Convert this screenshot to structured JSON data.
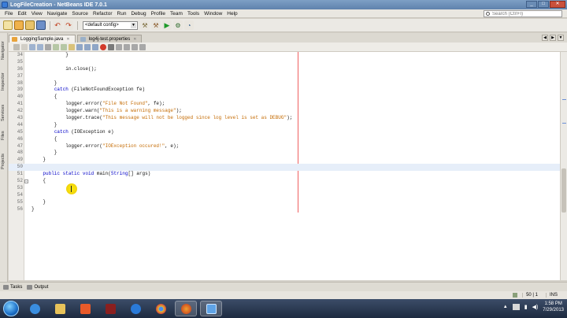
{
  "window": {
    "title": "LogFileCreation - NetBeans IDE 7.0.1"
  },
  "menu": [
    "File",
    "Edit",
    "View",
    "Navigate",
    "Source",
    "Refactor",
    "Run",
    "Debug",
    "Profile",
    "Team",
    "Tools",
    "Window",
    "Help"
  ],
  "search": {
    "placeholder": "Search (Ctrl+I)"
  },
  "toolbar": {
    "config_value": "<default config>"
  },
  "sidebar_tabs": [
    "Navigator",
    "Inspector",
    "Services",
    "Files",
    "Projects"
  ],
  "editor_tabs": [
    {
      "label": "LoggingSample.java",
      "active": true
    },
    {
      "label": "log4j-test.properties",
      "active": false
    }
  ],
  "code_lines": [
    {
      "num": "34",
      "code": "            }"
    },
    {
      "num": "35",
      "code": ""
    },
    {
      "num": "36",
      "code": "            in.close();"
    },
    {
      "num": "37",
      "code": ""
    },
    {
      "num": "38",
      "code": "        }"
    },
    {
      "num": "39",
      "code": "        catch (FileNotFoundException fe)"
    },
    {
      "num": "40",
      "code": "        {"
    },
    {
      "num": "41",
      "code": "            logger.error(\"File Not Found\", fe);"
    },
    {
      "num": "42",
      "code": "            logger.warn(\"This is a warning message\");"
    },
    {
      "num": "43",
      "code": "            logger.trace(\"This message will not be logged since log level is set as DEBUG\");"
    },
    {
      "num": "44",
      "code": "        }"
    },
    {
      "num": "45",
      "code": "        catch (IOException e)"
    },
    {
      "num": "46",
      "code": "        {"
    },
    {
      "num": "47",
      "code": "            logger.error(\"IOException occured!\", e);"
    },
    {
      "num": "48",
      "code": "        }"
    },
    {
      "num": "49",
      "code": "    }"
    },
    {
      "num": "50",
      "code": ""
    },
    {
      "num": "51",
      "code": "    public static void main(String[] args)"
    },
    {
      "num": "52",
      "code": "    {"
    },
    {
      "num": "53",
      "code": ""
    },
    {
      "num": "54",
      "code": ""
    },
    {
      "num": "55",
      "code": "    }"
    },
    {
      "num": "56",
      "code": "}"
    }
  ],
  "output": {
    "tab1": "Tasks",
    "tab2": "Output"
  },
  "status": {
    "insert_mode": "INS",
    "position": "50 | 1"
  },
  "clock": {
    "time": "1:58 PM",
    "date": "7/29/2013"
  },
  "colors": {
    "keyword": "#0000c8",
    "string": "#c46a00",
    "current_line": "#e6eef9",
    "margin": "#f06060"
  }
}
